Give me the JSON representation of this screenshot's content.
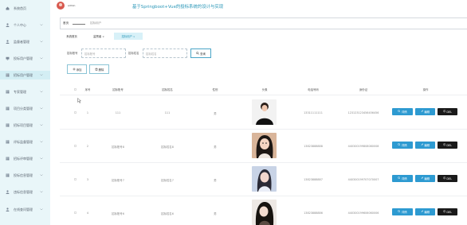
{
  "header": {
    "username": "admin",
    "app_title": "基于Springboot+Vue的投标系统的设计与实现"
  },
  "sidebar": {
    "items": [
      {
        "label": "系统首页",
        "icon": "home-icon",
        "chevron": false
      },
      {
        "label": "个人中心",
        "icon": "user-icon",
        "chevron": true
      },
      {
        "label": "监督者管理",
        "icon": "user-icon",
        "chevron": true
      },
      {
        "label": "投标用户管理",
        "icon": "monitor-icon",
        "chevron": true
      },
      {
        "label": "招标用户管理",
        "icon": "grid-icon",
        "chevron": true,
        "active": true
      },
      {
        "label": "专家管理",
        "icon": "grid-icon",
        "chevron": true
      },
      {
        "label": "项目分类管理",
        "icon": "grid-icon",
        "chevron": true
      },
      {
        "label": "招标项目管理",
        "icon": "grid-icon",
        "chevron": true
      },
      {
        "label": "评标监督管理",
        "icon": "grid-icon",
        "chevron": true
      },
      {
        "label": "招标评审管理",
        "icon": "grid-icon",
        "chevron": true
      },
      {
        "label": "投标信息管理",
        "icon": "grid-icon",
        "chevron": true
      },
      {
        "label": "违标信息管理",
        "icon": "user-icon",
        "chevron": true
      },
      {
        "label": "在线查问管理",
        "icon": "user-icon",
        "chevron": true
      }
    ]
  },
  "breadcrumb": {
    "home": "首页",
    "current": "招标用户"
  },
  "tabs": [
    {
      "label": "系统首页",
      "closable": false
    },
    {
      "label": "监督者",
      "closable": true
    },
    {
      "label": "招标用户",
      "closable": true,
      "active": true
    }
  ],
  "search": {
    "field1_label": "招标账号",
    "field1_placeholder": "招标账号",
    "field2_label": "招标姓名",
    "field2_placeholder": "招标姓名",
    "button_label": "查询"
  },
  "actions": {
    "add_label": "添加",
    "delete_label": "删除"
  },
  "table": {
    "columns": [
      "序号",
      "招标账号",
      "招标姓名",
      "性别",
      "头像",
      "电话号码",
      "身份证",
      "操作"
    ],
    "rows": [
      {
        "index": "1",
        "account": "111",
        "name": "111",
        "gender": "男",
        "phone": "13311111111",
        "id_card": "123123123456456456"
      },
      {
        "index": "2",
        "account": "招标账号8",
        "name": "招标姓名8",
        "gender": "男",
        "phone": "13823888888",
        "id_card": "440300199808080008"
      },
      {
        "index": "3",
        "account": "招标账号7",
        "name": "招标姓名7",
        "gender": "男",
        "phone": "13823888887",
        "id_card": "440300199707070007"
      },
      {
        "index": "4",
        "account": "招标账号6",
        "name": "招标姓名6",
        "gender": "男",
        "phone": "13823888886",
        "id_card": "440300199606060006"
      }
    ],
    "row_actions": {
      "detail": "详情",
      "edit": "编辑",
      "del": "DEL"
    }
  },
  "colors": {
    "accent": "#2d9ad1",
    "sidebar_bg": "#e9f6f9",
    "delete": "#1a1a1a"
  }
}
